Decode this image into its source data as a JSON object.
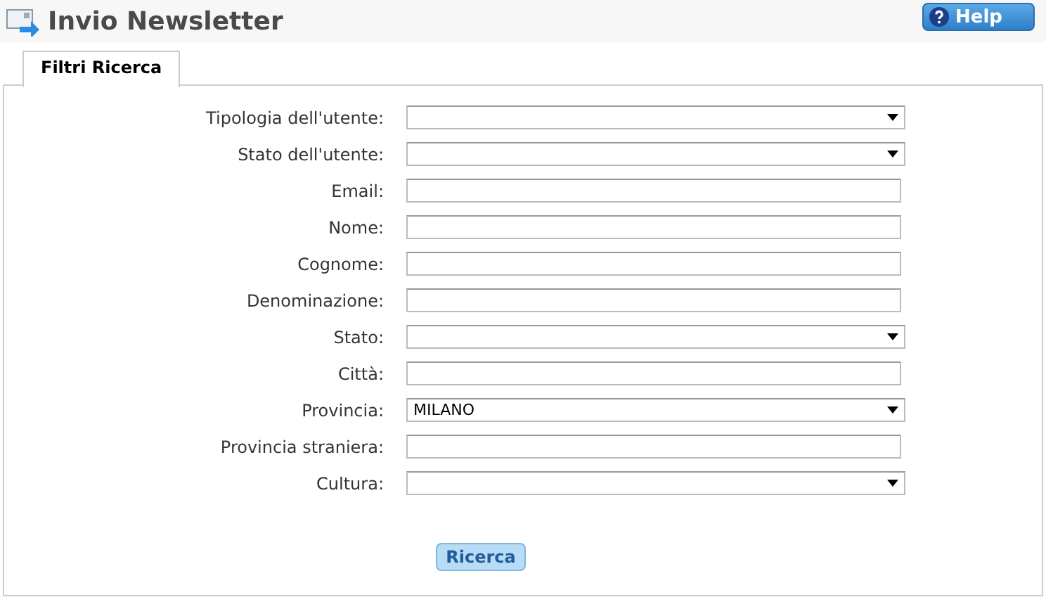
{
  "header": {
    "title": "Invio Newsletter",
    "help_button": "Help"
  },
  "tabs": [
    {
      "label": "Filtri Ricerca",
      "selected": true
    }
  ],
  "fields": [
    {
      "label": "Tipologia dell'utente:",
      "kind": "select"
    },
    {
      "label": "Stato dell'utente:",
      "kind": "select"
    },
    {
      "label": "Email:",
      "kind": "text"
    },
    {
      "label": "Nome:",
      "kind": "text"
    },
    {
      "label": "Cognome:",
      "kind": "text"
    },
    {
      "label": "Denominazione:",
      "kind": "text"
    },
    {
      "label": "Stato:",
      "kind": "select"
    },
    {
      "label": "Città:",
      "kind": "text"
    },
    {
      "label": "Provincia:",
      "kind": "select",
      "value": "MILANO"
    },
    {
      "label": "Provincia straniera:",
      "kind": "text"
    },
    {
      "label": "Cultura:",
      "kind": "select"
    }
  ],
  "search_button": "Ricerca"
}
